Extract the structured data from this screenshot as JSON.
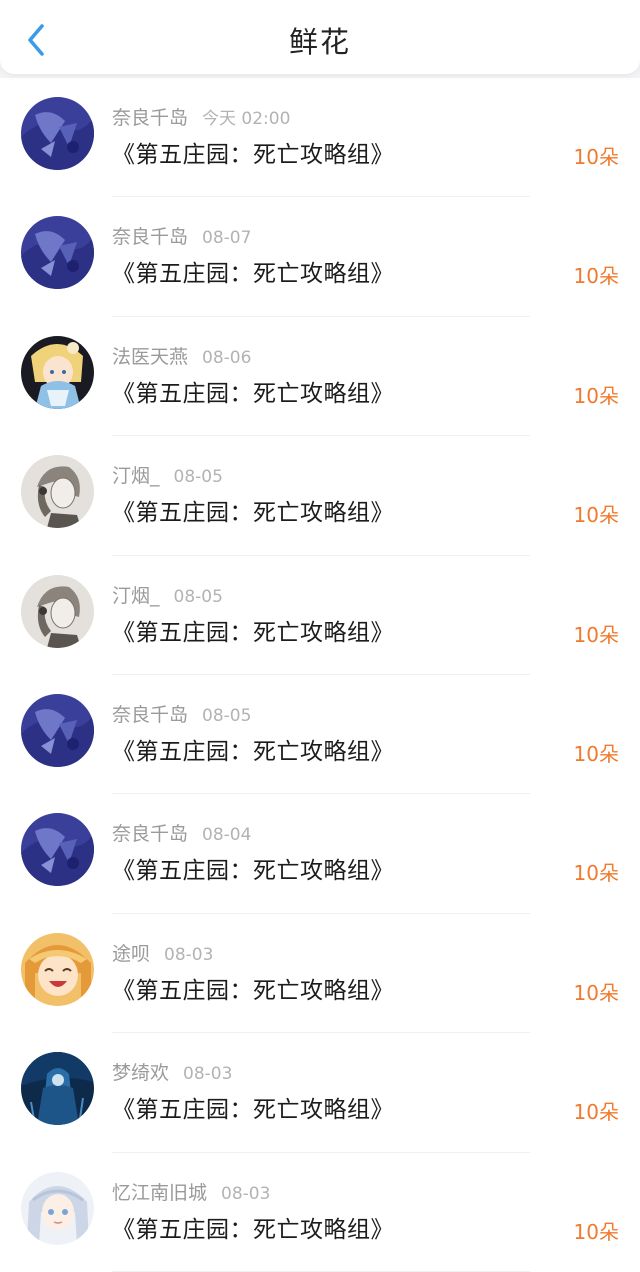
{
  "header": {
    "title": "鲜花",
    "back_icon": "chevron-left-icon",
    "accent_color": "#3b9be8"
  },
  "colors": {
    "count_color": "#f07a2e",
    "name_color": "#9a9a9a",
    "text_color": "#1c1c1c"
  },
  "items": [
    {
      "user": "奈良千岛",
      "date": "今天 02:00",
      "work": "《第五庄园：死亡攻略组》",
      "count": "10朵",
      "avatar": "blue-art"
    },
    {
      "user": "奈良千岛",
      "date": "08-07",
      "work": "《第五庄园：死亡攻略组》",
      "count": "10朵",
      "avatar": "blue-art"
    },
    {
      "user": "法医天燕",
      "date": "08-06",
      "work": "《第五庄园：死亡攻略组》",
      "count": "10朵",
      "avatar": "blonde-anime"
    },
    {
      "user": "汀烟_",
      "date": "08-05",
      "work": "《第五庄园：死亡攻略组》",
      "count": "10朵",
      "avatar": "sketch-girl"
    },
    {
      "user": "汀烟_",
      "date": "08-05",
      "work": "《第五庄园：死亡攻略组》",
      "count": "10朵",
      "avatar": "sketch-girl"
    },
    {
      "user": "奈良千岛",
      "date": "08-05",
      "work": "《第五庄园：死亡攻略组》",
      "count": "10朵",
      "avatar": "blue-art"
    },
    {
      "user": "奈良千岛",
      "date": "08-04",
      "work": "《第五庄园：死亡攻略组》",
      "count": "10朵",
      "avatar": "blue-art"
    },
    {
      "user": "途呗",
      "date": "08-03",
      "work": "《第五庄园：死亡攻略组》",
      "count": "10朵",
      "avatar": "laughing-anime"
    },
    {
      "user": "梦绮欢",
      "date": "08-03",
      "work": "《第五庄园：死亡攻略组》",
      "count": "10朵",
      "avatar": "dark-blue-figure"
    },
    {
      "user": "忆江南旧城",
      "date": "08-03",
      "work": "《第五庄园：死亡攻略组》",
      "count": "10朵",
      "avatar": "silver-hair-anime"
    }
  ]
}
